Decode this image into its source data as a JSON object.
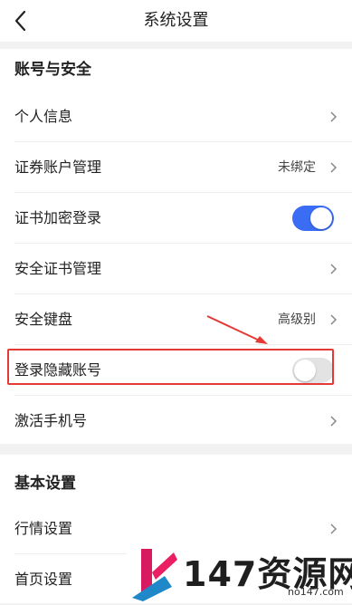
{
  "header": {
    "title": "系统设置"
  },
  "account_security": {
    "title": "账号与安全",
    "rows": {
      "personal_info": {
        "label": "个人信息"
      },
      "securities_account": {
        "label": "证券账户管理",
        "value": "未绑定"
      },
      "cert_encrypt_login": {
        "label": "证书加密登录",
        "toggle": "on"
      },
      "security_cert": {
        "label": "安全证书管理"
      },
      "secure_keyboard": {
        "label": "安全键盘",
        "value": "高级别"
      },
      "hide_account_login": {
        "label": "登录隐藏账号",
        "toggle": "off"
      },
      "activate_phone": {
        "label": "激活手机号"
      }
    }
  },
  "basic_settings": {
    "title": "基本设置",
    "rows": {
      "market": {
        "label": "行情设置"
      },
      "homepage": {
        "label": "首页设置"
      }
    }
  },
  "watermark": {
    "brand": "147资源网",
    "url": "no147.com"
  },
  "colors": {
    "accent": "#3a6cf4",
    "annotation": "#e53935",
    "background": "#f2f2f2"
  }
}
